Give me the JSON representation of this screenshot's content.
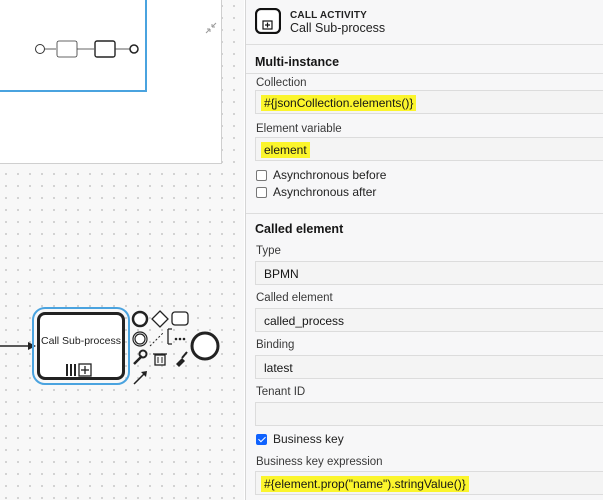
{
  "canvas": {
    "task_label": "Call Sub-process"
  },
  "header": {
    "type": "CALL ACTIVITY",
    "name": "Call Sub-process"
  },
  "multi_instance": {
    "title": "Multi-instance",
    "collection_label": "Collection",
    "collection_value": "#{jsonCollection.elements()}",
    "element_variable_label": "Element variable",
    "element_variable_value": "element",
    "async_before": "Asynchronous before",
    "async_after": "Asynchronous after"
  },
  "called_element": {
    "title": "Called element",
    "type_label": "Type",
    "type_value": "BPMN",
    "called_element_label": "Called element",
    "called_element_value": "called_process",
    "binding_label": "Binding",
    "binding_value": "latest",
    "tenant_label": "Tenant ID",
    "tenant_value": "",
    "business_key_label": "Business key",
    "business_key_expr_label": "Business key expression",
    "business_key_expr_value": "#{element.prop(\"name\").stringValue()}"
  },
  "colors": {
    "highlight": "#fbf52c",
    "selection": "#4aa3df",
    "checkbox": "#0f62fe"
  }
}
